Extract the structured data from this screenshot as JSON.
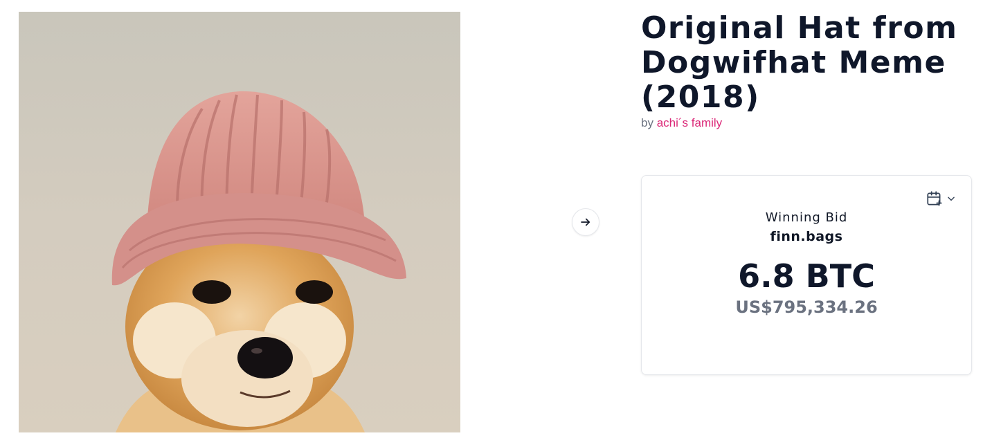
{
  "artwork": {
    "subject": "shiba-inu-in-pink-knit-hat",
    "colors": {
      "background": "#d2cbbf",
      "hat": "#d98f88",
      "fur": "#d99a4e"
    }
  },
  "navigation": {
    "next_icon": "arrow-right-icon"
  },
  "lot": {
    "title": "Original Hat from Dogwifhat Meme (2018)",
    "by_prefix": "by",
    "artist": "achi´s family"
  },
  "bid": {
    "calendar_icon": "calendar-plus-icon",
    "label": "Winning Bid",
    "bidder": "finn.bags",
    "amount": "6.8 BTC",
    "usd": "US$795,334.26"
  },
  "colors": {
    "title": "#0f172a",
    "accent": "#db2777",
    "muted": "#6b7280"
  }
}
